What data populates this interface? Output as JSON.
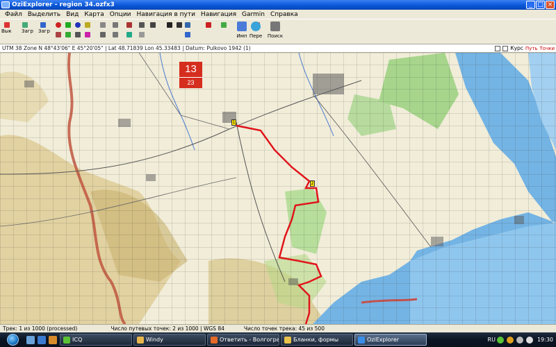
{
  "window": {
    "app_name": "OziExplorer",
    "title": "OziExplorer - region 34.ozfx3",
    "controls": [
      "_",
      "□",
      "×"
    ]
  },
  "menu": {
    "items": [
      "Файл",
      "Выделить",
      "Вид",
      "Карта",
      "Опции",
      "Навигация в пути",
      "Навигация",
      "Garmin",
      "Справка"
    ]
  },
  "toolbar": {
    "labels": [
      "Вык",
      "Загр",
      "Загр",
      "Имп",
      "Пере",
      "Поиск"
    ]
  },
  "map_info": {
    "text": "UTM 38 Zone N 48°43'06\" E 45°20'05\"  |  Lat 48.71839  Lon 45.33483  |  Datum: Pulkovo 1942 (1)",
    "right_labels": [
      "Курс",
      "Путь",
      "Точки"
    ]
  },
  "map": {
    "sheet_number": "13",
    "sheet_sub": "23",
    "waypoints": [
      "1",
      "2"
    ]
  },
  "status": {
    "left": "Трек: 1 из 1000 (processed)",
    "middle": "Число путевых точек: 2 из 1000  |  WGS 84",
    "right": "Число точек трека: 45 из 500"
  },
  "taskbar": {
    "tasks": [
      {
        "label": "ICQ",
        "color": "#5bc236"
      },
      {
        "label": "Windy",
        "color": "#e8b64a"
      },
      {
        "label": "Ответить - Волгоград",
        "color": "#e56a2a"
      },
      {
        "label": "Бланки, формы",
        "color": "#e8c24a"
      },
      {
        "label": "OziExplorer",
        "color": "#3a8ee6"
      }
    ],
    "lang": "RU",
    "clock": "19:30"
  },
  "colors": {
    "track": "#e0151b",
    "water": "#74b4e4",
    "forest": "#9ed183",
    "hills": "#d9c68c",
    "badge": "#d52d1e"
  }
}
